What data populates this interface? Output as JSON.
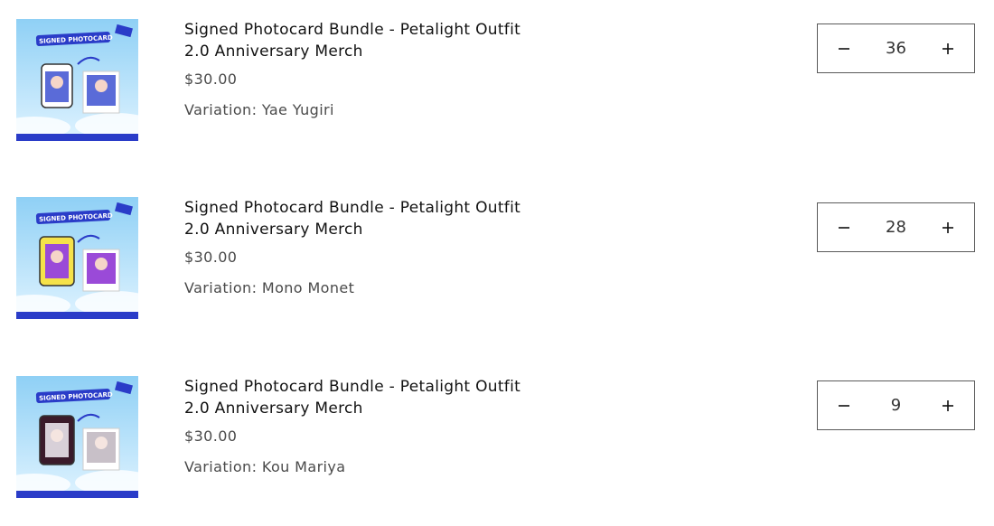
{
  "cart": {
    "items": [
      {
        "title_line1": "Signed Photocard Bundle - Petalight Outfit",
        "title_line2": "2.0 Anniversary Merch",
        "price": "$30.00",
        "variation": "Variation: Yae Yugiri",
        "quantity": "36",
        "image_label": "SIGNED PHOTOCARD",
        "accent": "#3a3ad0",
        "char_color": "#5a6bd8"
      },
      {
        "title_line1": "Signed Photocard Bundle - Petalight Outfit",
        "title_line2": "2.0 Anniversary Merch",
        "price": "$30.00",
        "variation": "Variation: Mono Monet",
        "quantity": "28",
        "image_label": "SIGNED PHOTOCARD",
        "accent": "#3a3ad0",
        "char_color": "#9a4ad8"
      },
      {
        "title_line1": "Signed Photocard Bundle - Petalight Outfit",
        "title_line2": "2.0 Anniversary Merch",
        "price": "$30.00",
        "variation": "Variation: Kou Mariya",
        "quantity": "9",
        "image_label": "SIGNED PHOTOCARD",
        "accent": "#3a3ad0",
        "char_color": "#6a2a4a"
      }
    ]
  },
  "icons": {
    "decrease": "minus-icon",
    "increase": "plus-icon"
  },
  "colors": {
    "border": "#5a5a5a",
    "text": "#121212",
    "muted": "#4a4a4a"
  }
}
